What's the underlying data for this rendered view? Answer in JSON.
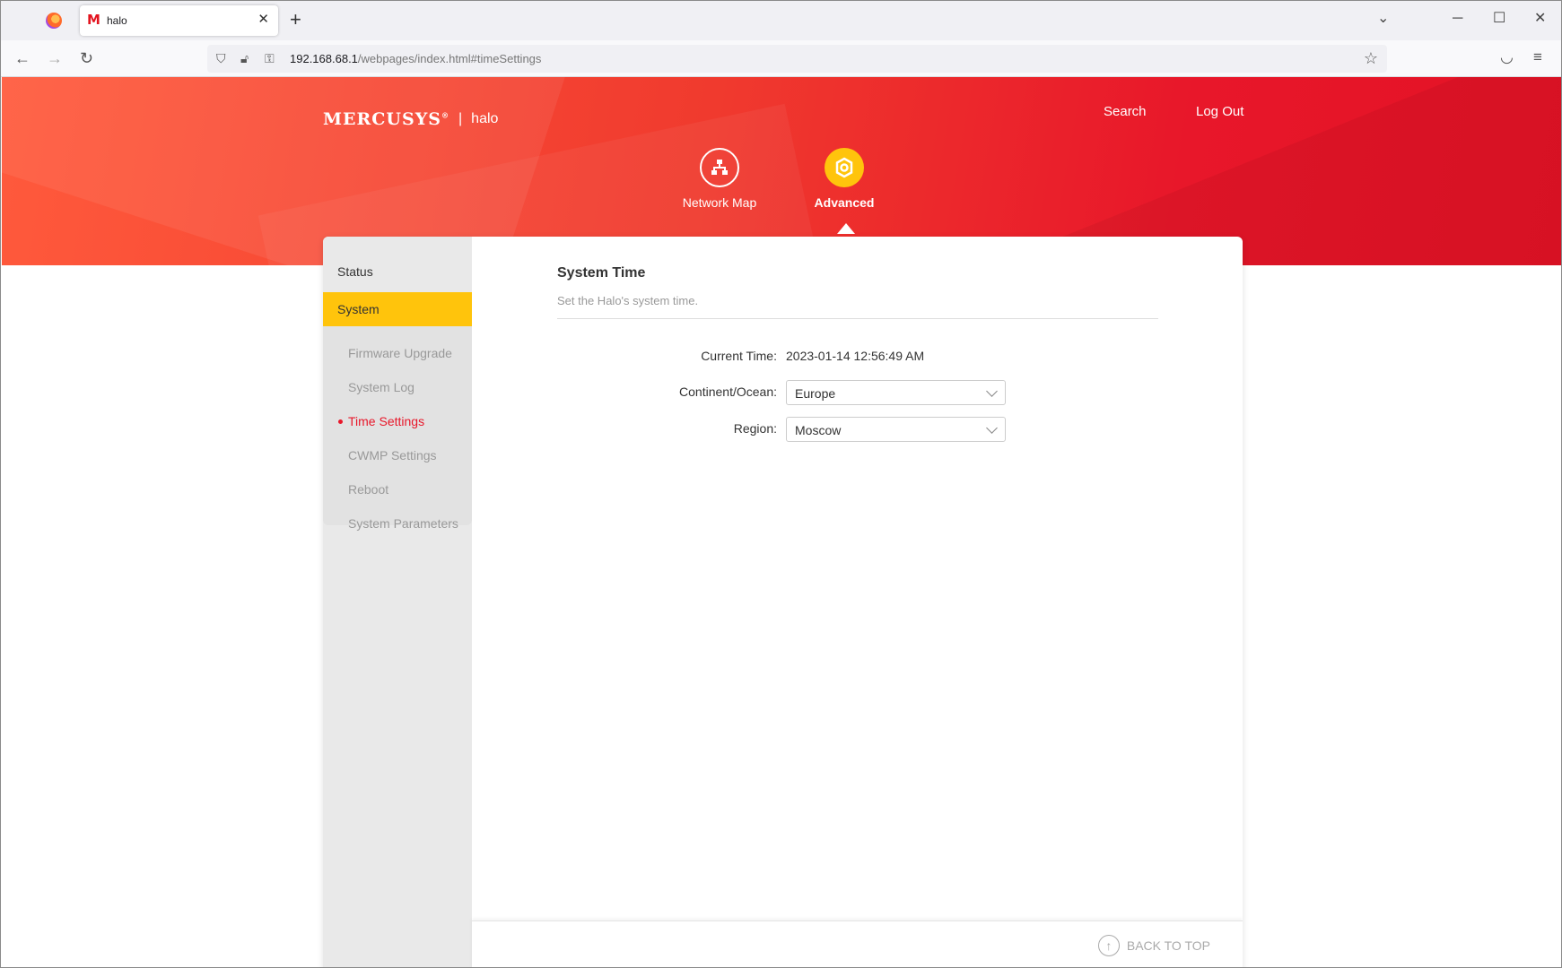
{
  "browser": {
    "tab_title": "halo",
    "tab_favicon": "M",
    "url_host": "192.168.68.1",
    "url_path": "/webpages/index.html#timeSettings",
    "icons": [
      "firefox-logo-icon",
      "close-icon",
      "plus-icon",
      "chevron-down-icon",
      "minimize-icon",
      "maximize-icon",
      "close-icon",
      "back-icon",
      "forward-icon",
      "reload-icon",
      "shield-icon",
      "lock-icon",
      "key-icon",
      "star-icon",
      "pocket-icon",
      "menu-icon"
    ]
  },
  "header": {
    "brand_logo": "MERCUSYS",
    "brand_trademark": "®",
    "brand_separator": "|",
    "device_name": "halo",
    "search_label": "Search",
    "logout_label": "Log Out"
  },
  "main_nav": [
    {
      "label": "Network Map",
      "icon": "network-map-icon",
      "active": false
    },
    {
      "label": "Advanced",
      "icon": "gear-icon",
      "active": true,
      "accent": "#ffc40c"
    }
  ],
  "sidebar": {
    "items": [
      {
        "label": "Status",
        "active": false
      },
      {
        "label": "System",
        "active": true
      }
    ],
    "sub_items": [
      {
        "label": "Firmware Upgrade",
        "active": false
      },
      {
        "label": "System Log",
        "active": false
      },
      {
        "label": "Time Settings",
        "active": true
      },
      {
        "label": "CWMP Settings",
        "active": false
      },
      {
        "label": "Reboot",
        "active": false
      },
      {
        "label": "System Parameters",
        "active": false
      }
    ]
  },
  "content": {
    "title": "System Time",
    "description": "Set the Halo's system time.",
    "current_time_label": "Current Time:",
    "current_time_value": "2023-01-14 12:56:49 AM",
    "continent_label": "Continent/Ocean:",
    "continent_value": "Europe",
    "region_label": "Region:",
    "region_value": "Moscow"
  },
  "footer": {
    "back_to_top": "BACK TO TOP"
  },
  "colors": {
    "brand_red": "#e8172a",
    "accent_yellow": "#ffc40c",
    "active_text": "#e8172a"
  }
}
